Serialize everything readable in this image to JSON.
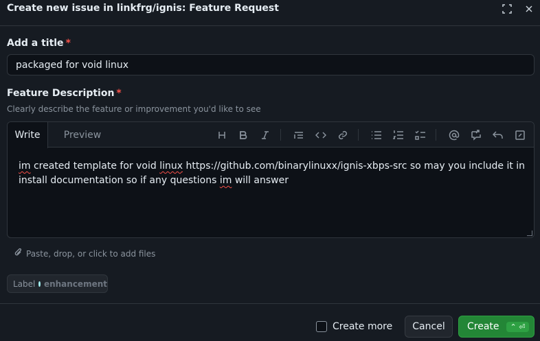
{
  "dialog": {
    "title": "Create new issue in linkfrg/ignis: Feature Request",
    "icons": [
      "fullscreen-icon",
      "close-icon"
    ]
  },
  "form": {
    "title_label": "Add a title",
    "required_mark": "*",
    "title_value": "packaged for void linux",
    "description_label": "Feature Description",
    "description_help": "Clearly describe the feature or improvement you'd like to see"
  },
  "editor": {
    "tabs": {
      "write": "Write",
      "preview": "Preview"
    },
    "toolbar_icons": [
      "heading-icon",
      "bold-icon",
      "italic-icon",
      "quote-icon",
      "code-icon",
      "link-icon",
      "unordered-list-icon",
      "ordered-list-icon",
      "task-list-icon",
      "mention-icon",
      "reference-icon",
      "undo-icon",
      "fullscreen-edit-icon"
    ],
    "body_parts": {
      "w1": "im",
      "t1": " created template for void ",
      "w2": "linux",
      "t2": " https://github.com/binarylinuxx/ignis-xbps-src so may you include it in install documentation so if any questions ",
      "w3": "im",
      "t3": " will answer"
    }
  },
  "attachments": {
    "text": "Paste, drop, or click to add files"
  },
  "labels": {
    "label_text": "Label",
    "value": "enhancement",
    "dot_color": "#a2eeef"
  },
  "footer": {
    "create_more": "Create more",
    "cancel": "Cancel",
    "create": "Create",
    "shortcut": "⌃ ⏎"
  },
  "colors": {
    "background": "#161b22",
    "input_bg": "#0d1117",
    "border": "#30363d",
    "primary_button": "#238636",
    "required": "#f85149"
  }
}
